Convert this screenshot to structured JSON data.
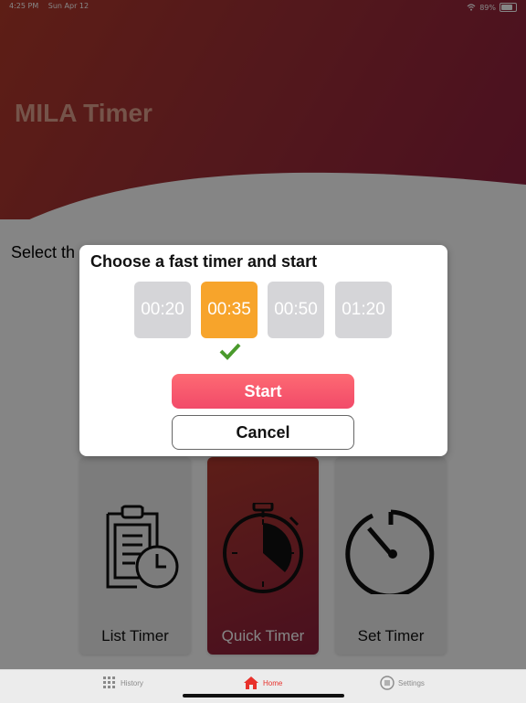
{
  "status_bar": {
    "time": "4:25 PM",
    "date": "Sun Apr 12",
    "battery": "89%"
  },
  "app": {
    "title": "MILA Timer"
  },
  "main": {
    "select_label": "Select th"
  },
  "cards": [
    {
      "label": "List Timer",
      "icon": "clipboard-clock-icon"
    },
    {
      "label": "Quick Timer",
      "icon": "stopwatch-icon"
    },
    {
      "label": "Set Timer",
      "icon": "timer-dial-icon"
    }
  ],
  "modal": {
    "title": "Choose a fast timer and start",
    "options": [
      "00:20",
      "00:35",
      "00:50",
      "01:20"
    ],
    "selected": "00:35",
    "start_label": "Start",
    "cancel_label": "Cancel"
  },
  "tabbar": {
    "items": [
      {
        "label": "History",
        "icon": "grid-icon",
        "active": false
      },
      {
        "label": "Home",
        "icon": "home-icon",
        "active": true
      },
      {
        "label": "Settings",
        "icon": "settings-icon",
        "active": false
      }
    ]
  },
  "colors": {
    "accent": "#f24a69",
    "selected_chip": "#f7a42b",
    "brand": "#a02f36",
    "active_tab": "#e8312b"
  }
}
